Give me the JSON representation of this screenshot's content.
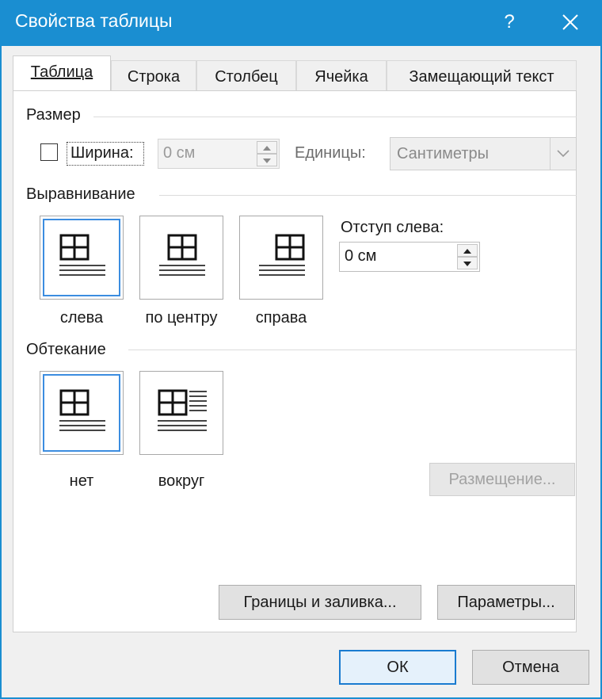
{
  "window": {
    "title": "Свойства таблицы",
    "help_glyph": "?"
  },
  "tabs": [
    {
      "label": "Таблица",
      "active": true
    },
    {
      "label": "Строка",
      "active": false
    },
    {
      "label": "Столбец",
      "active": false
    },
    {
      "label": "Ячейка",
      "active": false
    },
    {
      "label": "Замещающий текст",
      "active": false
    }
  ],
  "size": {
    "section_label": "Размер",
    "width_label": "Ширина:",
    "width_checked": false,
    "width_value": "0 см",
    "units_label": "Единицы:",
    "units_value": "Сантиметры"
  },
  "alignment": {
    "section_label": "Выравнивание",
    "options": [
      {
        "label": "слева",
        "selected": true,
        "icon": "table-align-left-icon"
      },
      {
        "label": "по центру",
        "selected": false,
        "icon": "table-align-center-icon"
      },
      {
        "label": "справа",
        "selected": false,
        "icon": "table-align-right-icon"
      }
    ],
    "indent_label": "Отступ слева:",
    "indent_value": "0 см"
  },
  "wrapping": {
    "section_label": "Обтекание",
    "options": [
      {
        "label": "нет",
        "selected": true,
        "icon": "wrap-none-icon"
      },
      {
        "label": "вокруг",
        "selected": false,
        "icon": "wrap-around-icon"
      }
    ],
    "positioning_label": "Размещение..."
  },
  "buttons": {
    "borders_label": "Границы и заливка...",
    "options_label": "Параметры...",
    "ok_label": "ОК",
    "cancel_label": "Отмена"
  },
  "colors": {
    "titlebar": "#1a8ed1",
    "selection": "#3c8de0",
    "ok_border": "#1a7bd0"
  }
}
